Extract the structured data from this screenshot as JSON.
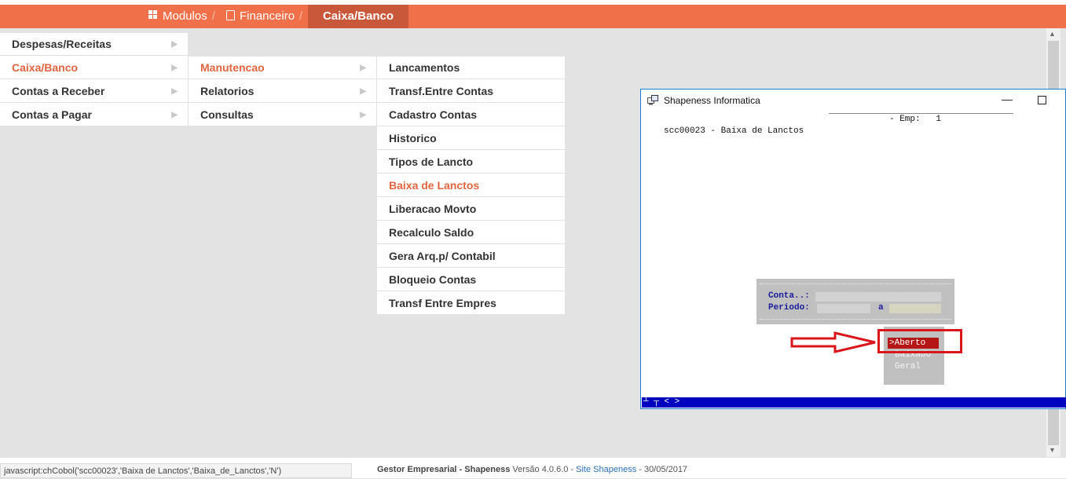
{
  "breadcrumb": {
    "items": [
      "Modulos",
      "Financeiro"
    ],
    "separator": "/",
    "active": "Caixa/Banco"
  },
  "menu_level1": [
    {
      "label": "Despesas/Receitas",
      "active": false
    },
    {
      "label": "Caixa/Banco",
      "active": true
    },
    {
      "label": "Contas a Receber",
      "active": false
    },
    {
      "label": "Contas a Pagar",
      "active": false
    }
  ],
  "menu_level2": [
    {
      "label": "Manutencao",
      "active": true
    },
    {
      "label": "Relatorios",
      "active": false
    },
    {
      "label": "Consultas",
      "active": false
    }
  ],
  "menu_level3": [
    {
      "label": "Lancamentos",
      "active": false
    },
    {
      "label": "Transf.Entre Contas",
      "active": false
    },
    {
      "label": "Cadastro Contas",
      "active": false
    },
    {
      "label": "Historico",
      "active": false
    },
    {
      "label": "Tipos de Lancto",
      "active": false
    },
    {
      "label": "Baixa de Lanctos",
      "active": true
    },
    {
      "label": "Liberacao Movto",
      "active": false
    },
    {
      "label": "Recalculo Saldo",
      "active": false
    },
    {
      "label": "Gera Arq.p/ Contabil",
      "active": false
    },
    {
      "label": "Bloqueio Contas",
      "active": false
    },
    {
      "label": "Transf Entre Empres",
      "active": false
    }
  ],
  "dialog": {
    "title": "Shapeness Informatica",
    "emp_line": "- Emp:   1",
    "program_line": "scc00023 - Baixa de Lanctos",
    "conta_label": "Conta..:",
    "periodo_label": "Periodo:",
    "periodo_sep": "a",
    "options": [
      ">Aberto",
      "Baixado",
      "Geral"
    ],
    "selected_option": ">Aberto",
    "termbar": "┴ ┬ < >"
  },
  "status_url": "javascript:chCobol('scc00023','Baixa de Lanctos','Baixa_de_Lanctos','N')",
  "footer": {
    "app": "Gestor Empresarial - Shapeness",
    "version": "Versão 4.0.6.0 -",
    "site": "Site Shapeness",
    "date": "- 30/05/2017"
  },
  "colors": {
    "brand_orange": "#f07049",
    "active_menu": "#e2653f",
    "term_blue": "#0000c0",
    "highlight_red": "#d9161c"
  }
}
